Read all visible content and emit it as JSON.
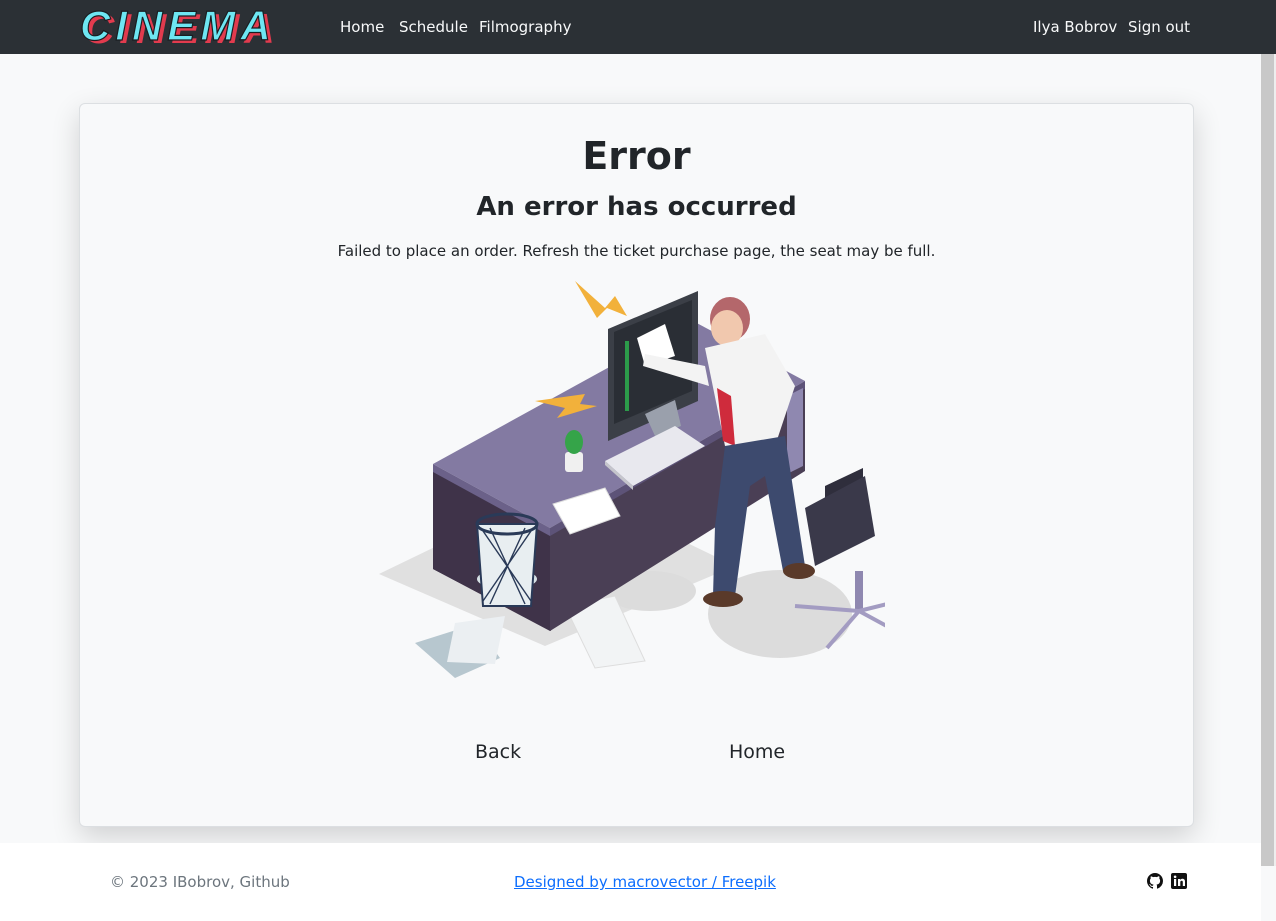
{
  "nav": {
    "brand": "CINEMA",
    "links": [
      "Home",
      "Schedule",
      "Filmography"
    ],
    "user": "Ilya Bobrov",
    "signout": "Sign out"
  },
  "error": {
    "title": "Error",
    "subtitle": "An error has occurred",
    "message": "Failed to place an order. Refresh the ticket purchase page, the seat may be full.",
    "illustration": "angry-man-punching-monitor"
  },
  "actions": {
    "back": "Back",
    "home": "Home"
  },
  "footer": {
    "copyright": "© 2023 IBobrov, Github",
    "credit": "Designed by macrovector / Freepik",
    "icons": [
      "github-icon",
      "linkedin-icon"
    ]
  },
  "colors": {
    "navbar": "#2b3035",
    "page": "#f8f9fa",
    "link": "#0d6efd",
    "brand_fill": "#6ee6f2",
    "brand_shadow": "#e23b4e"
  }
}
